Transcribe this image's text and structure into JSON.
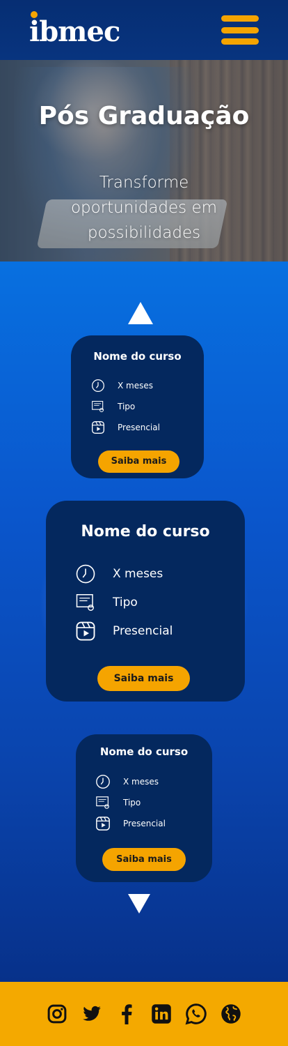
{
  "header": {
    "logo_text": "ibmec",
    "menu_icon": "hamburger-menu-icon",
    "colors": {
      "background": "#08347f",
      "accent": "#f5a400"
    }
  },
  "hero": {
    "title": "Pós Graduação",
    "subtitle": "Transforme oportunidades em possibilidades"
  },
  "carousel": {
    "up_icon": "chevron-up-icon",
    "down_icon": "chevron-down-icon",
    "cards": [
      {
        "title": "Nome do curso",
        "duration": "X meses",
        "type": "Tipo",
        "mode": "Presencial",
        "button": "Saiba mais"
      },
      {
        "title": "Nome do curso",
        "duration": "X meses",
        "type": "Tipo",
        "mode": "Presencial",
        "button": "Saiba mais"
      },
      {
        "title": "Nome do curso",
        "duration": "X meses",
        "type": "Tipo",
        "mode": "Presencial",
        "button": "Saiba mais"
      }
    ],
    "icons": {
      "duration": "clock-icon",
      "type": "certificate-icon",
      "mode": "play-icon"
    },
    "colors": {
      "card": "#04285e",
      "button": "#f5a400"
    }
  },
  "footer": {
    "icons": [
      "instagram-icon",
      "twitter-icon",
      "facebook-icon",
      "linkedin-icon",
      "whatsapp-icon",
      "globe-icon"
    ],
    "color": "#f4a900"
  }
}
